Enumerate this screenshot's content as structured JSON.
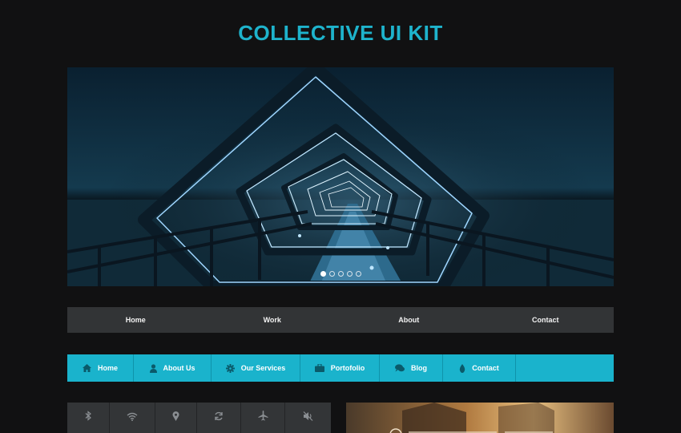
{
  "page": {
    "title": "COLLECTIVE UI KIT"
  },
  "slider": {
    "slide_count": 5,
    "active_index": 0
  },
  "nav_grey": {
    "items": [
      {
        "label": "Home"
      },
      {
        "label": "Work"
      },
      {
        "label": "About"
      },
      {
        "label": "Contact"
      }
    ]
  },
  "nav_cyan": {
    "items": [
      {
        "label": "Home",
        "icon": "home-icon"
      },
      {
        "label": "About Us",
        "icon": "user-icon"
      },
      {
        "label": "Our Services",
        "icon": "gear-icon"
      },
      {
        "label": "Portofolio",
        "icon": "briefcase-icon"
      },
      {
        "label": "Blog",
        "icon": "chat-icon"
      },
      {
        "label": "Contact",
        "icon": "fire-icon"
      }
    ]
  },
  "icon_bar": {
    "icons": [
      "bluetooth-icon",
      "wifi-icon",
      "location-pin-icon",
      "refresh-icon",
      "airplane-icon",
      "mute-icon"
    ]
  },
  "colors": {
    "accent": "#1eb3cc",
    "background": "#111112",
    "grey_nav": "#323436"
  }
}
